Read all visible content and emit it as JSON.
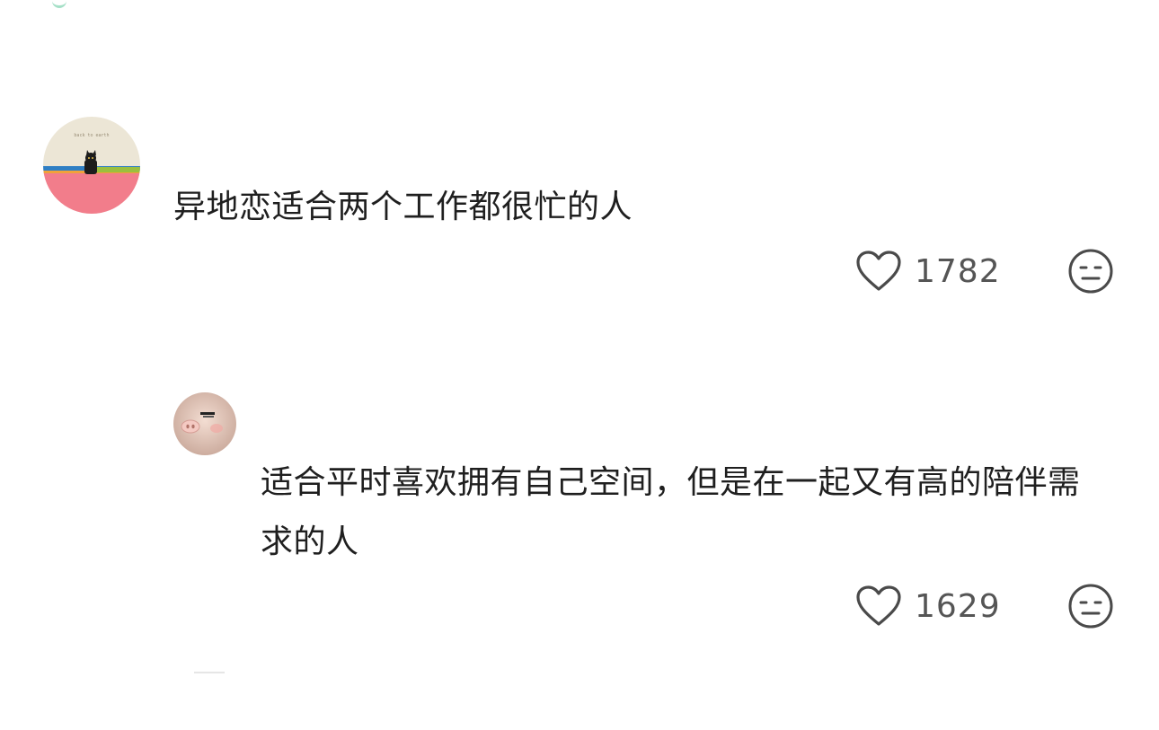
{
  "comments": [
    {
      "text": "异地恋适合两个工作都很忙的人",
      "likes": "1782",
      "avatar_caption": "back to earth",
      "icons": {
        "like": "heart-outline-icon",
        "dislike": "meh-face-icon"
      }
    },
    {
      "text": "适合平时喜欢拥有自己空间，但是在一起又有高的陪伴需求的人",
      "likes": "1629",
      "icons": {
        "like": "heart-outline-icon",
        "dislike": "meh-face-icon"
      }
    }
  ],
  "colors": {
    "text": "#1f1f1f",
    "count": "#555555",
    "icon": "#4a4a4a",
    "accent_pink": "#f07a86",
    "accent_mint": "#7fd3b0"
  }
}
